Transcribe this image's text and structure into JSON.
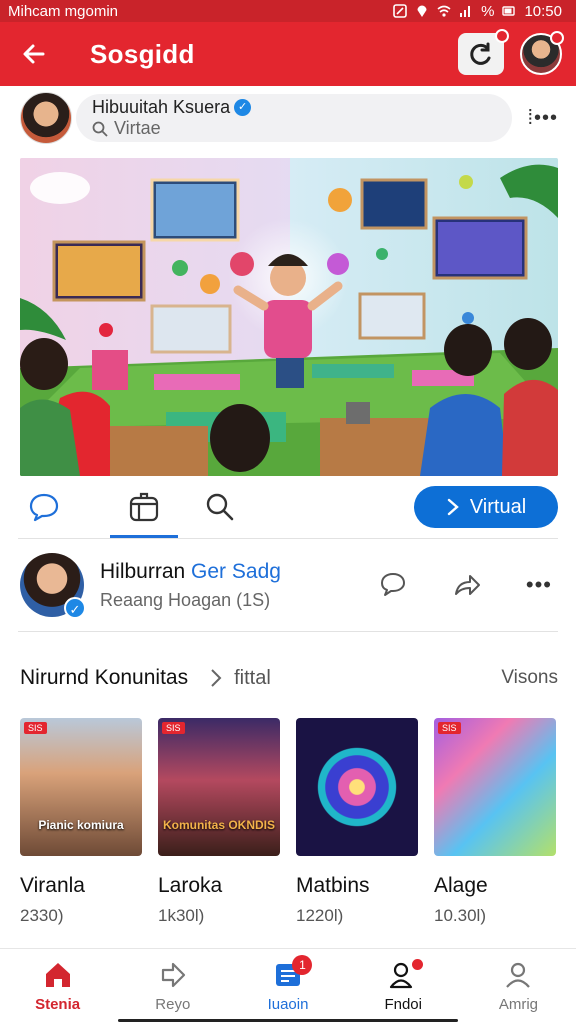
{
  "status_bar": {
    "carrier": "Mihcam mgomin",
    "battery": "%",
    "time": "10:50"
  },
  "app_bar": {
    "title": "Sosgidd"
  },
  "search_row": {
    "name": "Hibuuitah Ksuera",
    "placeholder": "Virtae"
  },
  "action_row": {
    "button_label": "Virtual"
  },
  "post": {
    "title_part1": "Hilburran ",
    "title_part2": "Ger Sadg",
    "subtitle": "Reaang Hoagan (1S)"
  },
  "section": {
    "title": "Nirurnd Konunitas",
    "link": "fittal",
    "right": "Visons"
  },
  "cards": [
    {
      "tag": "SIS",
      "caption": "Pianic komiura",
      "name": "Viranla",
      "count": "2330)"
    },
    {
      "tag": "SIS",
      "caption": "Komunitas OKNDIS",
      "name": "Laroka",
      "count": "1k30l)"
    },
    {
      "tag": "",
      "caption": "",
      "name": "Matbins",
      "count": "1220l)"
    },
    {
      "tag": "SIS",
      "caption": "",
      "name": "Alage",
      "count": "10.30l)"
    }
  ],
  "bottom_nav": [
    {
      "label": "Stenia",
      "icon": "home-icon"
    },
    {
      "label": "Reyo",
      "icon": "share-arrow-icon"
    },
    {
      "label": "Iuaoin",
      "icon": "inbox-icon",
      "badge": "1"
    },
    {
      "label": "Fndoi",
      "icon": "friends-icon"
    },
    {
      "label": "Amrig",
      "icon": "profile-icon"
    }
  ],
  "colors": {
    "brand_red": "#e3262f",
    "accent_blue": "#0d6fd6"
  }
}
